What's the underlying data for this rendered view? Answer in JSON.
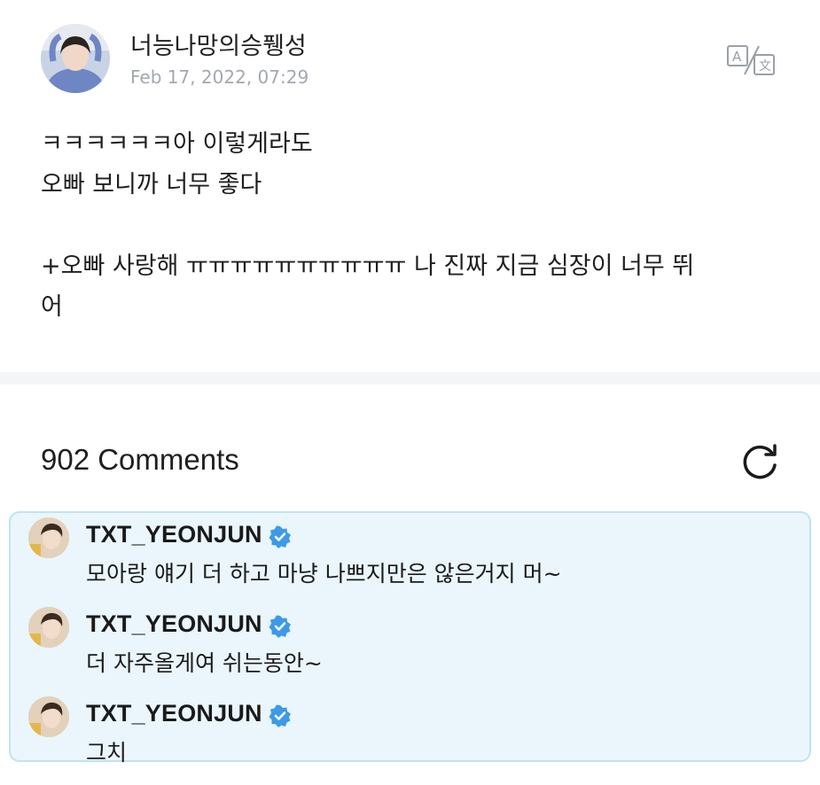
{
  "post": {
    "author": "너능나망의승퓅성",
    "timestamp": "Feb 17, 2022, 07:29",
    "body": "ㅋㅋㅋㅋㅋㅋ아 이렇게라도\n오빠 보니까 너무 좋다\n\n+오빠 사랑해 ㅠㅠㅠㅠㅠㅠㅠㅠㅠㅠ 나 진짜 지금 심장이 너무 뛰\n어",
    "translate_icon": "translate-icon"
  },
  "comments": {
    "count_label": "902 Comments",
    "refresh_icon": "refresh-icon",
    "items": [
      {
        "user": "TXT_YEONJUN",
        "text": "모아랑 얘기 더 하고 마냥 나쁘지만은 않은거지 머~",
        "verified": true
      },
      {
        "user": "TXT_YEONJUN",
        "text": "더 자주올게여 쉬는동안~",
        "verified": true
      },
      {
        "user": "TXT_YEONJUN",
        "text": "그치",
        "verified": true
      }
    ]
  },
  "colors": {
    "verified_badge": "#3d9ae8",
    "comment_bg": "#eaf6fb",
    "comment_border": "#bfe4ef",
    "timestamp": "#a3a8b0"
  }
}
